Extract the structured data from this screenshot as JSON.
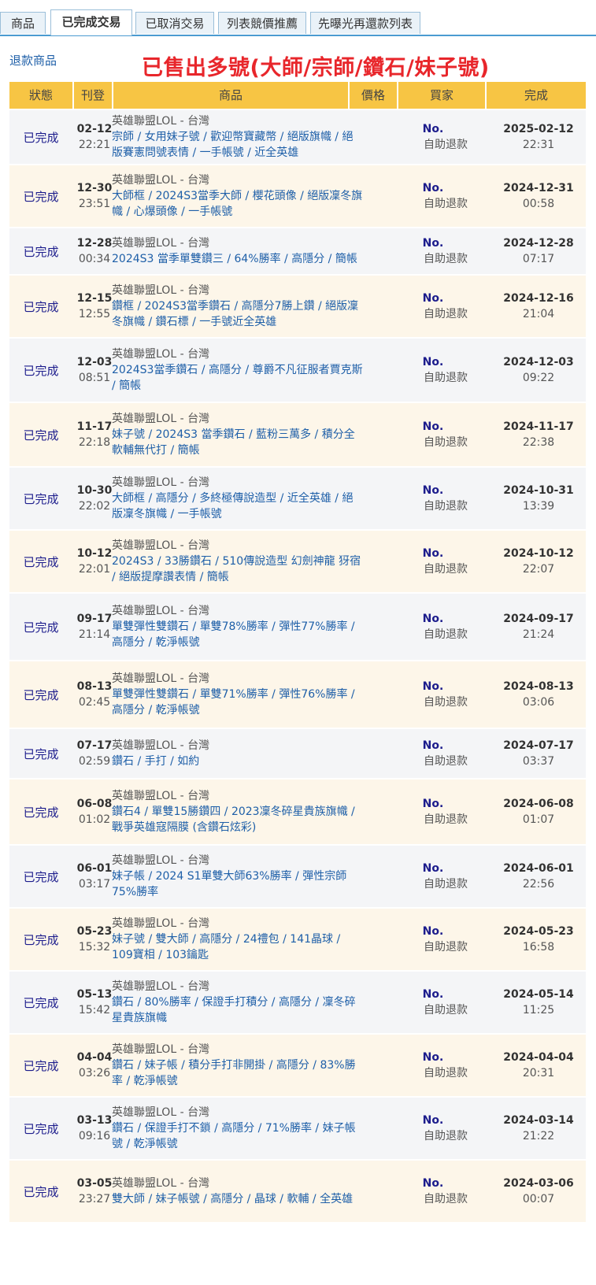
{
  "tabs": [
    "商品",
    "已完成交易",
    "已取消交易",
    "列表競價推薦",
    "先曝光再還款列表"
  ],
  "active_tab": 1,
  "refund_link": "退款商品",
  "sold_title": "已售出多號(大師/宗師/鑽石/妹子號)",
  "columns": [
    "狀態",
    "刊登",
    "商品",
    "價格",
    "買家",
    "完成"
  ],
  "rows": [
    {
      "status": "已完成",
      "pub_date": "02-12",
      "pub_time": "22:21",
      "game": "英雄聯盟LOL - 台灣",
      "desc": "宗師 / 女用妹子號 / 歡迎幣寶藏幣 / 絕版旗幟 / 絕版賽憲問號表情 / 一手帳號 / 近全英雄",
      "buyer_no": "No.",
      "buyer_name": "自助退款",
      "done_date": "2025-02-12",
      "done_time": "22:31"
    },
    {
      "status": "已完成",
      "pub_date": "12-30",
      "pub_time": "23:51",
      "game": "英雄聯盟LOL - 台灣",
      "desc": "大師框 / 2024S3當季大師 / 櫻花頭像 / 絕版凜冬旗幟 / 心爆頭像 / 一手帳號",
      "buyer_no": "No.",
      "buyer_name": "自助退款",
      "done_date": "2024-12-31",
      "done_time": "00:58"
    },
    {
      "status": "已完成",
      "pub_date": "12-28",
      "pub_time": "00:34",
      "game": "英雄聯盟LOL - 台灣",
      "desc": "2024S3 當季單雙鑽三 / 64%勝率 / 高隱分 / 簡帳",
      "buyer_no": "No.",
      "buyer_name": "自助退款",
      "done_date": "2024-12-28",
      "done_time": "07:17"
    },
    {
      "status": "已完成",
      "pub_date": "12-15",
      "pub_time": "12:55",
      "game": "英雄聯盟LOL - 台灣",
      "desc": "鑽框 / 2024S3當季鑽石 / 高隱分7勝上鑽 / 絕版凜冬旗幟 / 鑽石標 / 一手號近全英雄",
      "buyer_no": "No.",
      "buyer_name": "自助退款",
      "done_date": "2024-12-16",
      "done_time": "21:04"
    },
    {
      "status": "已完成",
      "pub_date": "12-03",
      "pub_time": "08:51",
      "game": "英雄聯盟LOL - 台灣",
      "desc": "2024S3當季鑽石 / 高隱分 / 尊爵不凡征服者賈克斯 / 簡帳",
      "buyer_no": "No.",
      "buyer_name": "自助退款",
      "done_date": "2024-12-03",
      "done_time": "09:22"
    },
    {
      "status": "已完成",
      "pub_date": "11-17",
      "pub_time": "22:18",
      "game": "英雄聯盟LOL - 台灣",
      "desc": "妹子號 / 2024S3 當季鑽石 / 藍粉三萬多 / 積分全軟輔無代打 / 簡帳",
      "buyer_no": "No.",
      "buyer_name": "自助退款",
      "done_date": "2024-11-17",
      "done_time": "22:38"
    },
    {
      "status": "已完成",
      "pub_date": "10-30",
      "pub_time": "22:02",
      "game": "英雄聯盟LOL - 台灣",
      "desc": "大師框 / 高隱分 / 多終極傳說造型 / 近全英雄 / 絕版凜冬旗幟 / 一手帳號",
      "buyer_no": "No.",
      "buyer_name": "自助退款",
      "done_date": "2024-10-31",
      "done_time": "13:39"
    },
    {
      "status": "已完成",
      "pub_date": "10-12",
      "pub_time": "22:01",
      "game": "英雄聯盟LOL - 台灣",
      "desc": "2024S3 / 33勝鑽石 / 510傳說造型 幻劍神龍 犽宿 / 絕版提摩讚表情 / 簡帳",
      "buyer_no": "No.",
      "buyer_name": "自助退款",
      "done_date": "2024-10-12",
      "done_time": "22:07"
    },
    {
      "status": "已完成",
      "pub_date": "09-17",
      "pub_time": "21:14",
      "game": "英雄聯盟LOL - 台灣",
      "desc": "單雙彈性雙鑽石 / 單雙78%勝率 / 彈性77%勝率 / 高隱分 / 乾淨帳號",
      "buyer_no": "No.",
      "buyer_name": "自助退款",
      "done_date": "2024-09-17",
      "done_time": "21:24"
    },
    {
      "status": "已完成",
      "pub_date": "08-13",
      "pub_time": "02:45",
      "game": "英雄聯盟LOL - 台灣",
      "desc": "單雙彈性雙鑽石 / 單雙71%勝率 / 彈性76%勝率 / 高隱分 / 乾淨帳號",
      "buyer_no": "No.",
      "buyer_name": "自助退款",
      "done_date": "2024-08-13",
      "done_time": "03:06"
    },
    {
      "status": "已完成",
      "pub_date": "07-17",
      "pub_time": "02:59",
      "game": "英雄聯盟LOL - 台灣",
      "desc": "鑽石 / 手打 / 如約",
      "buyer_no": "No.",
      "buyer_name": "自助退款",
      "done_date": "2024-07-17",
      "done_time": "03:37"
    },
    {
      "status": "已完成",
      "pub_date": "06-08",
      "pub_time": "01:02",
      "game": "英雄聯盟LOL - 台灣",
      "desc": "鑽石4 / 單雙15勝鑽四 / 2023凜冬碎星貴族旗幟 / 戰爭英雄寇隔膜 (含鑽石炫彩)",
      "buyer_no": "No.",
      "buyer_name": "自助退款",
      "done_date": "2024-06-08",
      "done_time": "01:07"
    },
    {
      "status": "已完成",
      "pub_date": "06-01",
      "pub_time": "03:17",
      "game": "英雄聯盟LOL - 台灣",
      "desc": "妹子帳 / 2024 S1單雙大師63%勝率 / 彈性宗師75%勝率",
      "buyer_no": "No.",
      "buyer_name": "自助退款",
      "done_date": "2024-06-01",
      "done_time": "22:56"
    },
    {
      "status": "已完成",
      "pub_date": "05-23",
      "pub_time": "15:32",
      "game": "英雄聯盟LOL - 台灣",
      "desc": "妹子號 / 雙大師 / 高隱分 / 24禮包 / 141晶球 / 109寶相 / 103鑰匙",
      "buyer_no": "No.",
      "buyer_name": "自助退款",
      "done_date": "2024-05-23",
      "done_time": "16:58"
    },
    {
      "status": "已完成",
      "pub_date": "05-13",
      "pub_time": "15:42",
      "game": "英雄聯盟LOL - 台灣",
      "desc": "鑽石 / 80%勝率 / 保證手打積分 / 高隱分 / 凜冬碎星貴族旗幟",
      "buyer_no": "No.",
      "buyer_name": "自助退款",
      "done_date": "2024-05-14",
      "done_time": "11:25"
    },
    {
      "status": "已完成",
      "pub_date": "04-04",
      "pub_time": "03:26",
      "game": "英雄聯盟LOL - 台灣",
      "desc": "鑽石 / 妹子帳 / 積分手打非開掛 / 高隱分 / 83%勝率 / 乾淨帳號",
      "buyer_no": "No.",
      "buyer_name": "自助退款",
      "done_date": "2024-04-04",
      "done_time": "20:31"
    },
    {
      "status": "已完成",
      "pub_date": "03-13",
      "pub_time": "09:16",
      "game": "英雄聯盟LOL - 台灣",
      "desc": "鑽石 / 保證手打不鎖 / 高隱分 / 71%勝率 / 妹子帳號 / 乾淨帳號",
      "buyer_no": "No.",
      "buyer_name": "自助退款",
      "done_date": "2024-03-14",
      "done_time": "21:22"
    },
    {
      "status": "已完成",
      "pub_date": "03-05",
      "pub_time": "23:27",
      "game": "英雄聯盟LOL - 台灣",
      "desc": "雙大師 / 妹子帳號 / 高隱分 / 晶球 / 軟輔 / 全英雄",
      "buyer_no": "No.",
      "buyer_name": "自助退款",
      "done_date": "2024-03-06",
      "done_time": "00:07"
    }
  ]
}
